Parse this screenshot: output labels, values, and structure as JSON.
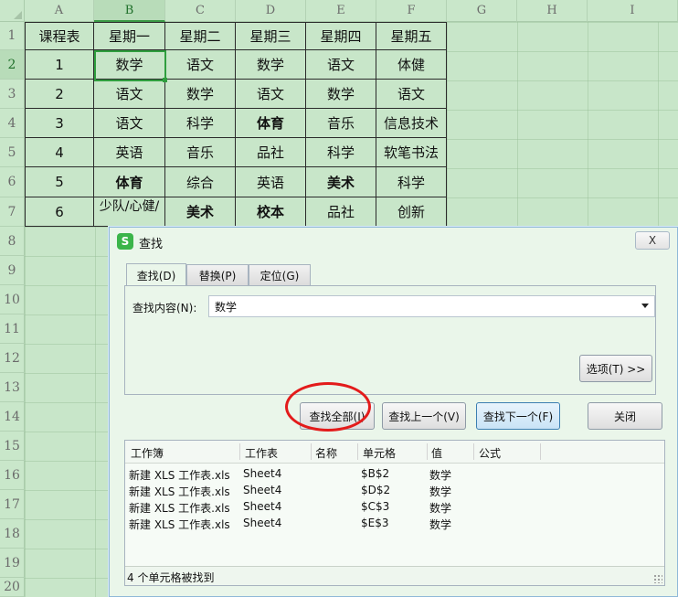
{
  "columns": [
    "A",
    "B",
    "C",
    "D",
    "E",
    "F",
    "G",
    "H",
    "I"
  ],
  "rows": [
    "1",
    "2",
    "3",
    "4",
    "5",
    "6",
    "7",
    "8",
    "9",
    "10",
    "11",
    "12",
    "13",
    "14",
    "15",
    "16",
    "17",
    "18",
    "19",
    "20"
  ],
  "table": [
    [
      "课程表",
      "星期一",
      "星期二",
      "星期三",
      "星期四",
      "星期五"
    ],
    [
      "1",
      "数学",
      "语文",
      "数学",
      "语文",
      "体健"
    ],
    [
      "2",
      "语文",
      "数学",
      "语文",
      "数学",
      "语文"
    ],
    [
      "3",
      "语文",
      "科学",
      "体育",
      "音乐",
      "信息技术"
    ],
    [
      "4",
      "英语",
      "音乐",
      "品社",
      "科学",
      "软笔书法"
    ],
    [
      "5",
      "体育",
      "综合",
      "英语",
      "美术",
      "科学"
    ],
    [
      "6",
      "少队/心健/",
      "美术",
      "校本",
      "品社",
      "创新"
    ]
  ],
  "bold_cells": [
    "3-3",
    "5-1",
    "5-4",
    "6-2",
    "6-3"
  ],
  "dialog": {
    "title": "查找",
    "app_icon": "S",
    "close_symbol": "X",
    "tabs": [
      {
        "label": "查找(D)",
        "active": true
      },
      {
        "label": "替换(P)",
        "active": false
      },
      {
        "label": "定位(G)",
        "active": false
      }
    ],
    "find_label": "查找内容(N):",
    "find_value": "数学",
    "options_button": "选项(T) >>",
    "buttons": {
      "find_all": "查找全部(I)",
      "find_prev": "查找上一个(V)",
      "find_next": "查找下一个(F)",
      "close": "关闭"
    },
    "results_headers": [
      "工作簿",
      "工作表",
      "名称",
      "单元格",
      "值",
      "公式"
    ],
    "results": [
      [
        "新建 XLS 工作表.xls",
        "Sheet4",
        "",
        "$B$2",
        "数学",
        ""
      ],
      [
        "新建 XLS 工作表.xls",
        "Sheet4",
        "",
        "$D$2",
        "数学",
        ""
      ],
      [
        "新建 XLS 工作表.xls",
        "Sheet4",
        "",
        "$C$3",
        "数学",
        ""
      ],
      [
        "新建 XLS 工作表.xls",
        "Sheet4",
        "",
        "$E$3",
        "数学",
        ""
      ]
    ],
    "status": "4 个单元格被找到"
  },
  "colors": {
    "sheet_bg": "#c8e6c9",
    "selection": "#2f9e3e",
    "annotation_ring": "#e31b1b",
    "app_icon": "#3bb54a"
  }
}
